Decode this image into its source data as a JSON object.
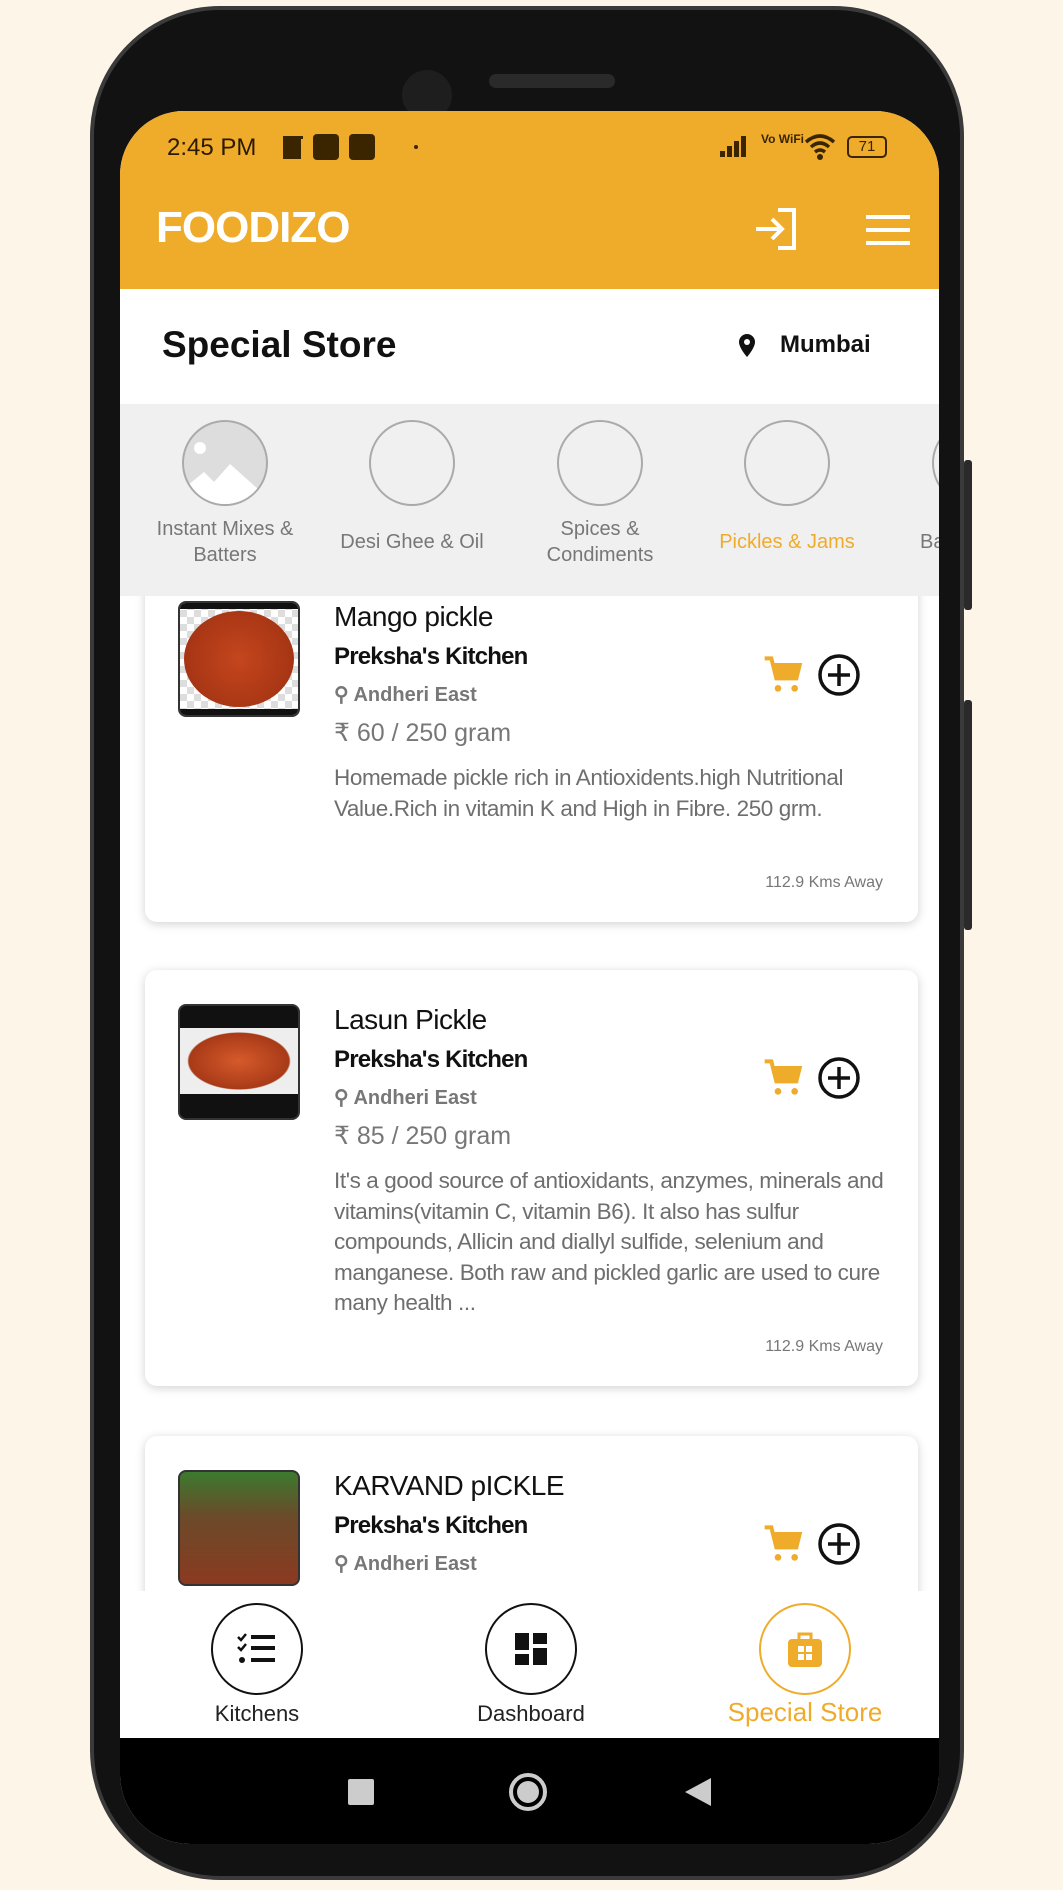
{
  "status_bar": {
    "time": "2:45 PM",
    "network": "Vo WiFi",
    "battery": "71"
  },
  "header": {
    "logo": "FOODIZO",
    "login_icon": "login-icon",
    "menu_icon": "hamburger-menu-icon",
    "accent": "#efab2a"
  },
  "page": {
    "title": "Special Store",
    "location": "Mumbai"
  },
  "categories": [
    {
      "label": "Instant Mixes & Batters",
      "active": false
    },
    {
      "label": "Desi Ghee & Oil",
      "active": false
    },
    {
      "label": "Spices & Condiments",
      "active": false
    },
    {
      "label": "Pickles & Jams",
      "active": true
    },
    {
      "label": "Bake",
      "active": false
    }
  ],
  "products": [
    {
      "name": "Mango pickle",
      "kitchen": "Preksha's Kitchen",
      "location": "Andheri East",
      "price": "₹ 60 / 250 gram",
      "description": "Homemade pickle rich in Antioxidents.high Nutritional Value.Rich in vitamin K and High in Fibre. 250 grm.",
      "distance": "112.9 Kms Away"
    },
    {
      "name": "Lasun Pickle",
      "kitchen": "Preksha's Kitchen",
      "location": "Andheri East",
      "price": "₹ 85 / 250 gram",
      "description": "It's a good source of antioxidants, anzymes, minerals and vitamins(vitamin C, vitamin B6). It also has sulfur compounds, Allicin and diallyl sulfide, selenium and manganese. Both raw and pickled garlic are used to cure many health ...",
      "distance": "112.9 Kms Away"
    },
    {
      "name": "KARVAND pICKLE",
      "kitchen": "Preksha's Kitchen",
      "location": "Andheri East"
    }
  ],
  "bottom_nav": [
    {
      "label": "Kitchens",
      "active": false
    },
    {
      "label": "Dashboard",
      "active": false
    },
    {
      "label": "Special Store",
      "active": true
    }
  ]
}
